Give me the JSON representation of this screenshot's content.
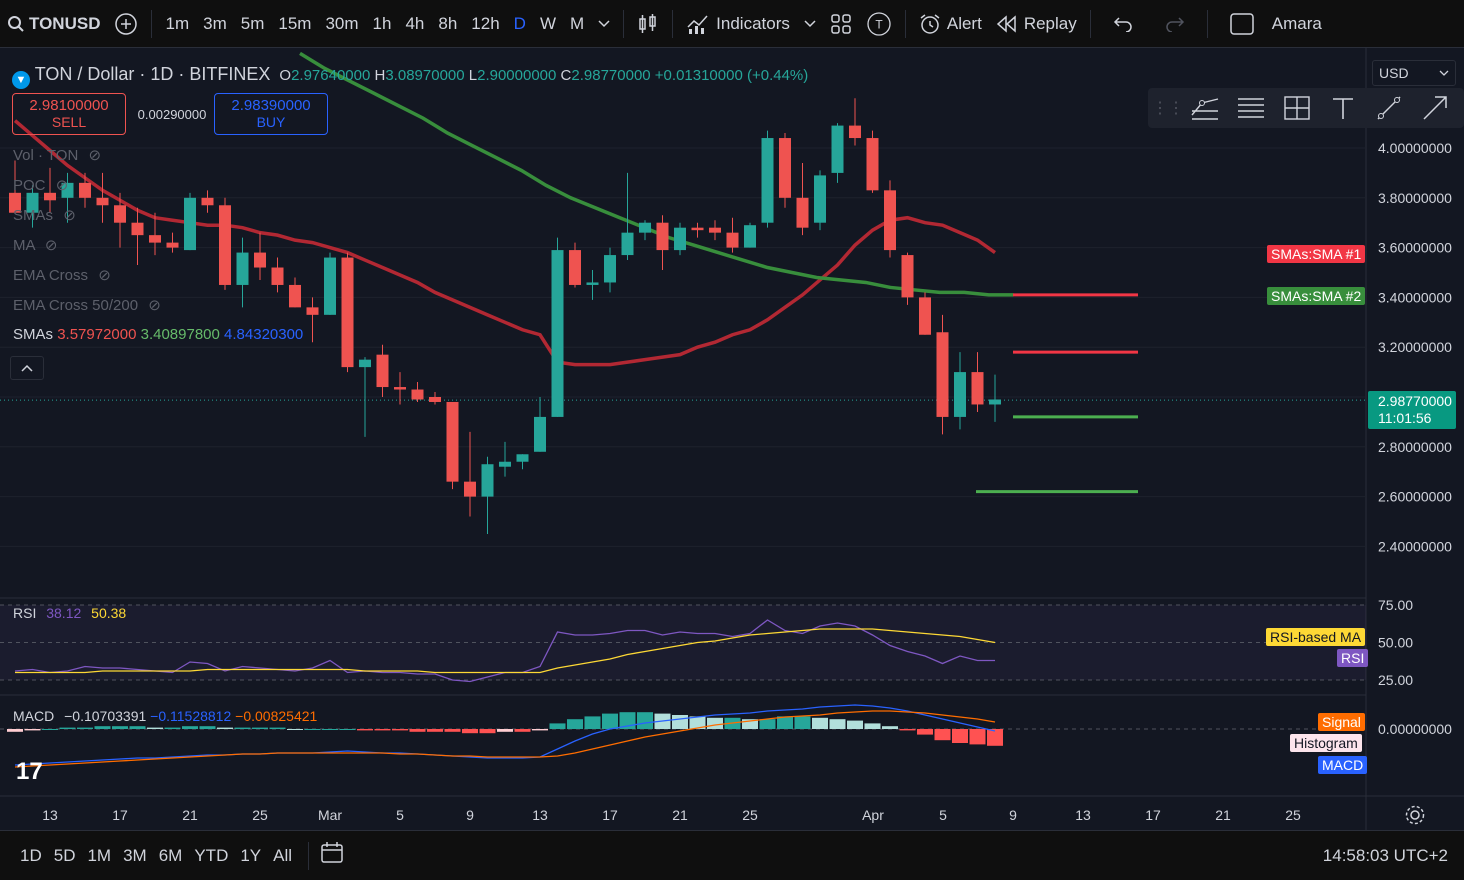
{
  "topbar": {
    "symbol": "TONUSD",
    "timeframes": [
      "1m",
      "3m",
      "5m",
      "15m",
      "30m",
      "1h",
      "4h",
      "8h",
      "12h",
      "D",
      "W",
      "M"
    ],
    "active_timeframe": "D",
    "indicators_label": "Indicators",
    "alert_label": "Alert",
    "replay_label": "Replay",
    "user_label": "Amara"
  },
  "legend": {
    "title": "TON / Dollar · 1D · BITFINEX",
    "open_label": "O",
    "open": "2.97640000",
    "high_label": "H",
    "high": "3.08970000",
    "low_label": "L",
    "low": "2.90000000",
    "close_label": "C",
    "close": "2.98770000",
    "change": "+0.01310000 (+0.44%)"
  },
  "trade": {
    "sell_price": "2.98100000",
    "sell_label": "SELL",
    "spread": "0.00290000",
    "buy_price": "2.98390000",
    "buy_label": "BUY"
  },
  "indicators_list": {
    "vol": "Vol · TON",
    "poc": "POC",
    "smas": "SMAs",
    "ma": "MA",
    "ema_cross": "EMA Cross",
    "ema_cross_50_200": "EMA Cross 50/200",
    "smas_label": "SMAs",
    "sma1": "3.57972000",
    "sma2": "3.40897800",
    "sma3": "4.84320300"
  },
  "currency_select": "USD",
  "price_axis": {
    "ticks": [
      "4.00000000",
      "3.80000000",
      "3.60000000",
      "3.40000000",
      "3.20000000",
      "2.80000000",
      "2.60000000",
      "2.40000000"
    ],
    "current_price": "2.98770000",
    "countdown": "11:01:56",
    "sma1_tag": "SMAs:SMA #1",
    "sma2_tag": "SMAs:SMA #2"
  },
  "rsi": {
    "label": "RSI",
    "value": "38.12",
    "ma_value": "50.38",
    "ticks": [
      "75.00",
      "50.00",
      "25.00"
    ],
    "ma_tag": "RSI-based MA",
    "rsi_tag": "RSI"
  },
  "macd": {
    "label": "MACD",
    "macd_value": "−0.10703391",
    "signal_value": "−0.11528812",
    "hist_value": "−0.00825421",
    "tick": "0.00000000",
    "signal_tag": "Signal",
    "histogram_tag": "Histogram",
    "macd_tag": "MACD"
  },
  "time_axis": [
    "13",
    "17",
    "21",
    "25",
    "Mar",
    "5",
    "9",
    "13",
    "17",
    "21",
    "25",
    "Apr",
    "5",
    "9",
    "13",
    "17",
    "21",
    "25"
  ],
  "bottombar": {
    "ranges": [
      "1D",
      "5D",
      "1M",
      "3M",
      "6M",
      "YTD",
      "1Y",
      "All"
    ],
    "clock": "14:58:03 UTC+2"
  },
  "colors": {
    "up": "#26a69a",
    "down": "#ef5350",
    "sma1": "#b22833",
    "sma2": "#388e3c",
    "rsi": "#7e57c2",
    "rsi_ma": "#fdd835",
    "macd": "#2962ff",
    "signal": "#ff6d00",
    "blue": "#2962ff"
  },
  "chart_data": {
    "type": "candlestick",
    "candles": [
      {
        "o": 3.82,
        "h": 3.95,
        "l": 3.74,
        "c": 3.74
      },
      {
        "o": 3.74,
        "h": 3.85,
        "l": 3.68,
        "c": 3.82
      },
      {
        "o": 3.82,
        "h": 3.92,
        "l": 3.74,
        "c": 3.79
      },
      {
        "o": 3.8,
        "h": 3.9,
        "l": 3.7,
        "c": 3.86
      },
      {
        "o": 3.86,
        "h": 3.9,
        "l": 3.76,
        "c": 3.8
      },
      {
        "o": 3.8,
        "h": 3.9,
        "l": 3.7,
        "c": 3.77
      },
      {
        "o": 3.77,
        "h": 3.82,
        "l": 3.6,
        "c": 3.7
      },
      {
        "o": 3.7,
        "h": 3.76,
        "l": 3.53,
        "c": 3.65
      },
      {
        "o": 3.65,
        "h": 3.74,
        "l": 3.57,
        "c": 3.62
      },
      {
        "o": 3.62,
        "h": 3.66,
        "l": 3.58,
        "c": 3.6
      },
      {
        "o": 3.59,
        "h": 3.82,
        "l": 3.59,
        "c": 3.8
      },
      {
        "o": 3.8,
        "h": 3.83,
        "l": 3.74,
        "c": 3.77
      },
      {
        "o": 3.77,
        "h": 3.8,
        "l": 3.43,
        "c": 3.45
      },
      {
        "o": 3.45,
        "h": 3.64,
        "l": 3.36,
        "c": 3.58
      },
      {
        "o": 3.58,
        "h": 3.66,
        "l": 3.47,
        "c": 3.52
      },
      {
        "o": 3.52,
        "h": 3.56,
        "l": 3.42,
        "c": 3.45
      },
      {
        "o": 3.45,
        "h": 3.48,
        "l": 3.36,
        "c": 3.36
      },
      {
        "o": 3.36,
        "h": 3.4,
        "l": 3.22,
        "c": 3.33
      },
      {
        "o": 3.33,
        "h": 3.58,
        "l": 3.33,
        "c": 3.56
      },
      {
        "o": 3.56,
        "h": 3.58,
        "l": 3.1,
        "c": 3.12
      },
      {
        "o": 3.12,
        "h": 3.16,
        "l": 2.84,
        "c": 3.15
      },
      {
        "o": 3.17,
        "h": 3.21,
        "l": 3.0,
        "c": 3.04
      },
      {
        "o": 3.04,
        "h": 3.1,
        "l": 2.97,
        "c": 3.03
      },
      {
        "o": 3.03,
        "h": 3.06,
        "l": 2.98,
        "c": 2.99
      },
      {
        "o": 3.0,
        "h": 3.02,
        "l": 2.97,
        "c": 2.98
      },
      {
        "o": 2.98,
        "h": 2.98,
        "l": 2.63,
        "c": 2.66
      },
      {
        "o": 2.66,
        "h": 2.86,
        "l": 2.52,
        "c": 2.6
      },
      {
        "o": 2.6,
        "h": 2.76,
        "l": 2.45,
        "c": 2.73
      },
      {
        "o": 2.72,
        "h": 2.82,
        "l": 2.68,
        "c": 2.74
      },
      {
        "o": 2.74,
        "h": 2.77,
        "l": 2.71,
        "c": 2.77
      },
      {
        "o": 2.78,
        "h": 3.0,
        "l": 2.78,
        "c": 2.92
      },
      {
        "o": 2.92,
        "h": 3.64,
        "l": 2.92,
        "c": 3.59
      },
      {
        "o": 3.59,
        "h": 3.62,
        "l": 3.44,
        "c": 3.45
      },
      {
        "o": 3.45,
        "h": 3.51,
        "l": 3.39,
        "c": 3.46
      },
      {
        "o": 3.46,
        "h": 3.6,
        "l": 3.42,
        "c": 3.57
      },
      {
        "o": 3.57,
        "h": 3.9,
        "l": 3.55,
        "c": 3.66
      },
      {
        "o": 3.66,
        "h": 3.71,
        "l": 3.63,
        "c": 3.7
      },
      {
        "o": 3.7,
        "h": 3.73,
        "l": 3.51,
        "c": 3.59
      },
      {
        "o": 3.59,
        "h": 3.7,
        "l": 3.57,
        "c": 3.68
      },
      {
        "o": 3.68,
        "h": 3.7,
        "l": 3.64,
        "c": 3.67
      },
      {
        "o": 3.68,
        "h": 3.71,
        "l": 3.63,
        "c": 3.66
      },
      {
        "o": 3.66,
        "h": 3.72,
        "l": 3.58,
        "c": 3.6
      },
      {
        "o": 3.6,
        "h": 3.7,
        "l": 3.6,
        "c": 3.69
      },
      {
        "o": 3.7,
        "h": 4.07,
        "l": 3.68,
        "c": 4.04
      },
      {
        "o": 4.04,
        "h": 4.06,
        "l": 3.76,
        "c": 3.8
      },
      {
        "o": 3.8,
        "h": 3.94,
        "l": 3.65,
        "c": 3.68
      },
      {
        "o": 3.7,
        "h": 3.91,
        "l": 3.67,
        "c": 3.89
      },
      {
        "o": 3.9,
        "h": 4.1,
        "l": 3.86,
        "c": 4.09
      },
      {
        "o": 4.09,
        "h": 4.2,
        "l": 4.01,
        "c": 4.04
      },
      {
        "o": 4.04,
        "h": 4.07,
        "l": 3.82,
        "c": 3.83
      },
      {
        "o": 3.83,
        "h": 3.87,
        "l": 3.56,
        "c": 3.59
      },
      {
        "o": 3.57,
        "h": 3.58,
        "l": 3.37,
        "c": 3.4
      },
      {
        "o": 3.4,
        "h": 3.42,
        "l": 3.25,
        "c": 3.25
      },
      {
        "o": 3.26,
        "h": 3.33,
        "l": 2.85,
        "c": 2.92
      },
      {
        "o": 2.92,
        "h": 3.18,
        "l": 2.87,
        "c": 3.1
      },
      {
        "o": 3.1,
        "h": 3.18,
        "l": 2.94,
        "c": 2.97
      },
      {
        "o": 2.97,
        "h": 3.09,
        "l": 2.9,
        "c": 2.99
      }
    ],
    "sma1_series": [
      4.11,
      4.05,
      3.99,
      3.93,
      3.88,
      3.83,
      3.79,
      3.75,
      3.72,
      3.71,
      3.7,
      3.69,
      3.69,
      3.68,
      3.66,
      3.65,
      3.63,
      3.62,
      3.6,
      3.58,
      3.55,
      3.52,
      3.49,
      3.46,
      3.42,
      3.39,
      3.36,
      3.33,
      3.3,
      3.27,
      3.25,
      3.14,
      3.13,
      3.13,
      3.13,
      3.14,
      3.15,
      3.16,
      3.17,
      3.2,
      3.22,
      3.25,
      3.27,
      3.31,
      3.36,
      3.41,
      3.47,
      3.53,
      3.61,
      3.67,
      3.71,
      3.72,
      3.7,
      3.69,
      3.66,
      3.63,
      3.58
    ],
    "sma2_series": [
      4.38,
      4.32,
      4.27,
      4.22,
      4.17,
      4.12,
      4.06,
      4.01,
      3.96,
      3.91,
      3.85,
      3.8,
      3.76,
      3.72,
      3.68,
      3.64,
      3.61,
      3.58,
      3.55,
      3.52,
      3.5,
      3.48,
      3.47,
      3.46,
      3.44,
      3.43,
      3.42,
      3.42,
      3.41,
      3.41
    ],
    "sma_ranges": {
      "y_min": 2.3,
      "y_max": 4.2
    },
    "drawn_levels": [
      3.41,
      3.18,
      2.92,
      2.62
    ]
  }
}
